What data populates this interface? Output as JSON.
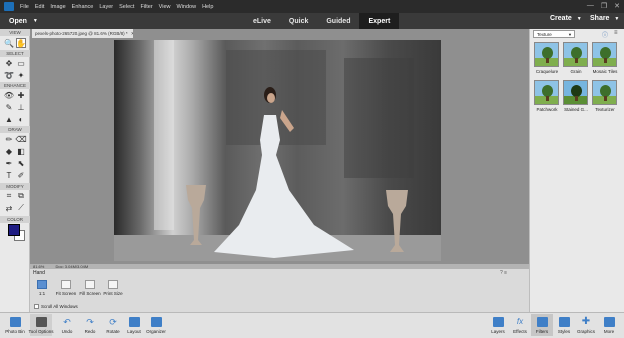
{
  "menubar": {
    "items": [
      "File",
      "Edit",
      "Image",
      "Enhance",
      "Layer",
      "Select",
      "Filter",
      "View",
      "Window",
      "Help"
    ],
    "window_buttons": [
      "—",
      "❐",
      "✕"
    ]
  },
  "modebar": {
    "open_label": "Open",
    "tabs": [
      "eLive",
      "Quick",
      "Guided",
      "Expert"
    ],
    "active_tab": "Expert",
    "create_label": "Create",
    "share_label": "Share"
  },
  "toolbar": {
    "sections": [
      "VIEW",
      "SELECT",
      "ENHANCE",
      "DRAW",
      "MODIFY",
      "COLOR"
    ],
    "colors": {
      "foreground": "#1f1c83",
      "background": "#ffffff"
    }
  },
  "document": {
    "tab_title": "pexels-photo-265720.jpeg @ 81.6% (RGB/8) *",
    "zoom_status": "81.6%",
    "doc_status": "Doc: 3.04M/3.04M"
  },
  "panel": {
    "category": "Texture",
    "filters": [
      "Craquelure",
      "Grain",
      "Mosaic Tiles",
      "Patchwork",
      "Stained G...",
      "Texturizer"
    ]
  },
  "tool_options": {
    "tool_name": "Hand",
    "zoom_value": "1:1",
    "buttons": [
      "Fit Screen",
      "Fill Screen",
      "Print Size"
    ],
    "scroll_all": "Scroll All Windows"
  },
  "taskbar": {
    "left": [
      "Photo Bin",
      "Tool Options",
      "Undo",
      "Redo",
      "Rotate",
      "Layout",
      "Organizer"
    ],
    "right": [
      "Layers",
      "Effects",
      "Filters",
      "Styles",
      "Graphics",
      "More"
    ],
    "active": "Filters"
  }
}
